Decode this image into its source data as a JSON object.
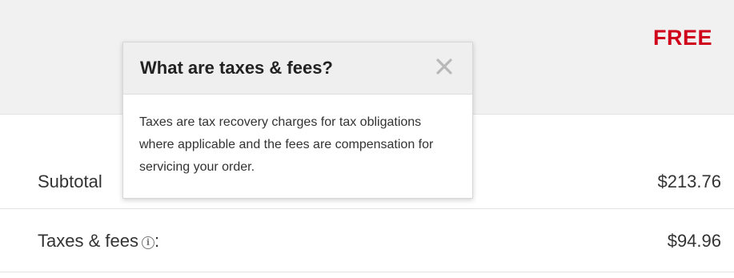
{
  "shipping": {
    "price": "FREE",
    "price_color": "#d0021b"
  },
  "summary": {
    "subtotal_label": "Subtotal",
    "subtotal_value": "$213.76",
    "taxes_label": "Taxes & fees",
    "taxes_colon": ":",
    "taxes_value": "$94.96",
    "info_icon": "info-icon"
  },
  "popover": {
    "title": "What are taxes & fees?",
    "body": "Taxes are tax recovery charges for tax obligations where applicable and the fees are compensation for servicing your order.",
    "close_icon": "close-icon"
  }
}
